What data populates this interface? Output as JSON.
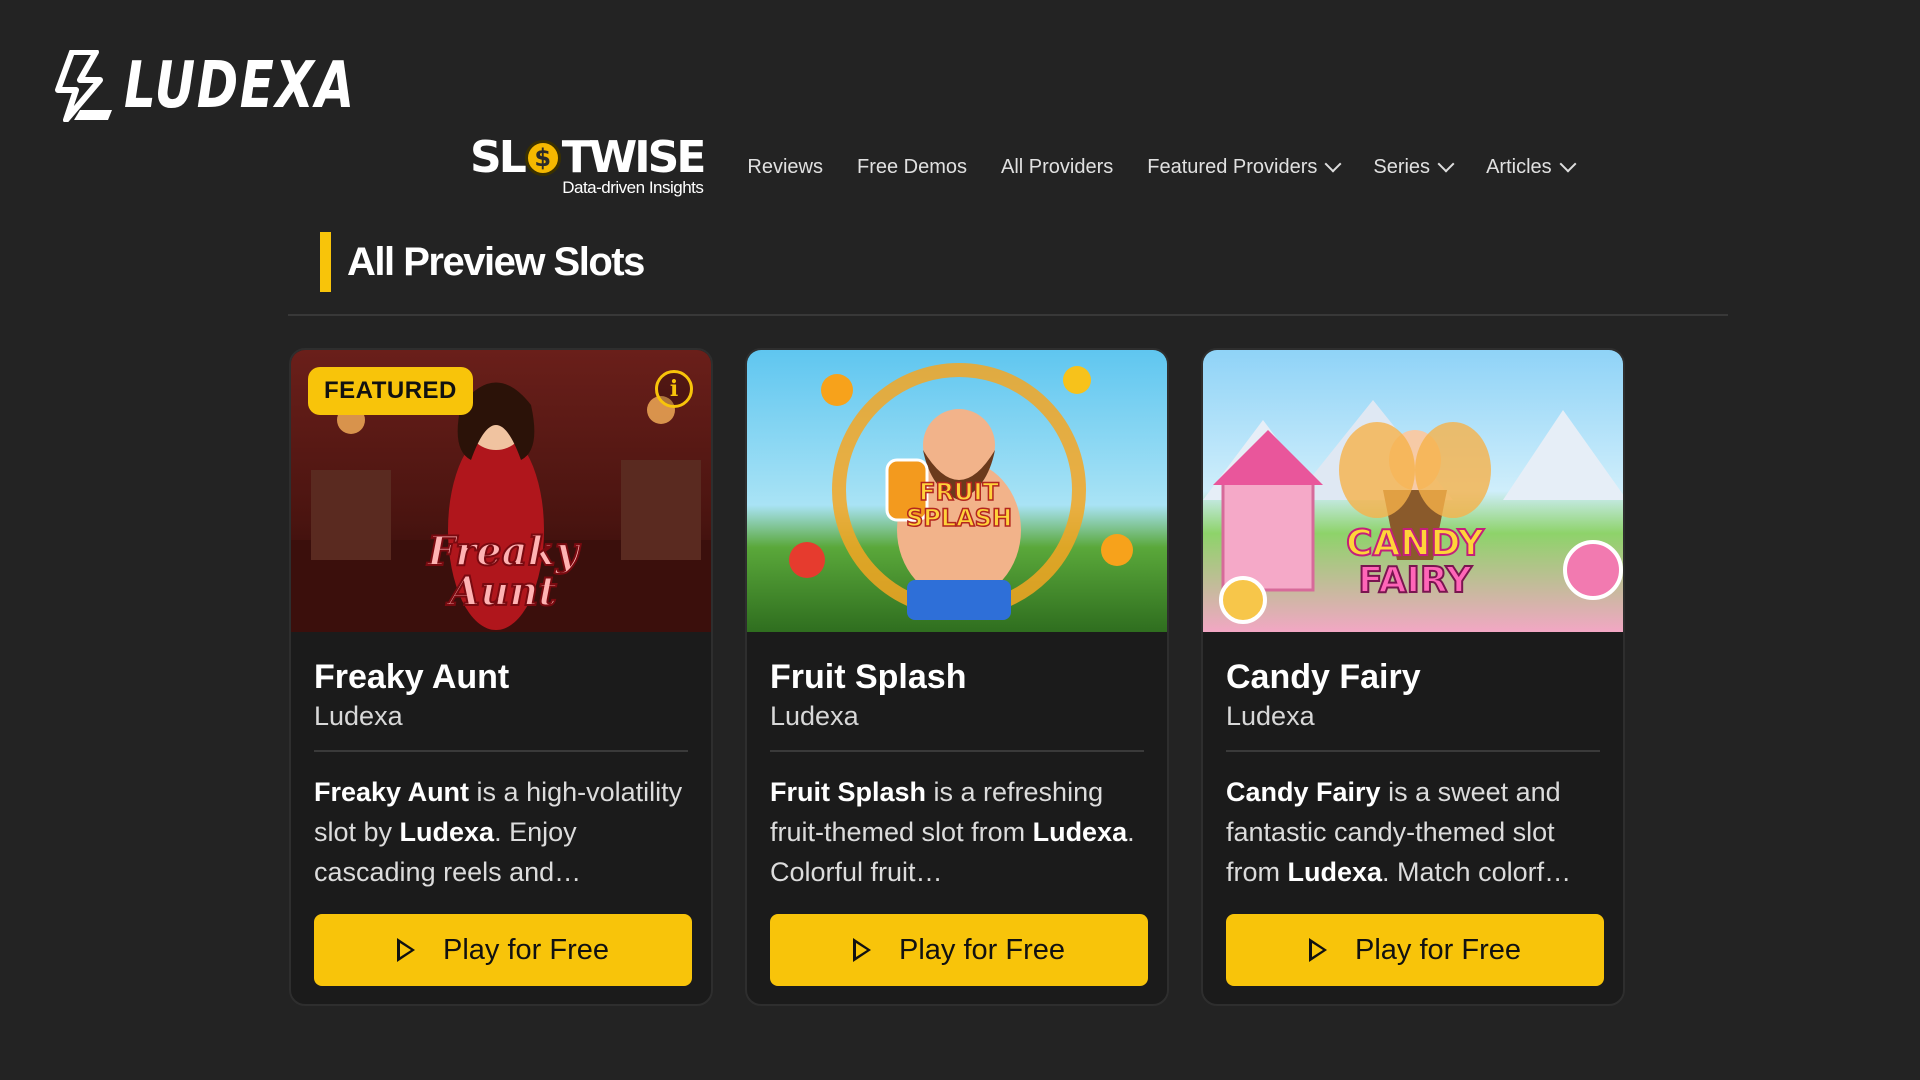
{
  "brand": {
    "name": "LUDEXA",
    "logo_icon": "lightning-l-icon"
  },
  "nav": {
    "logo_name": "SLOTWISE",
    "logo_tagline": "Data-driven Insights",
    "items": [
      {
        "label": "Reviews",
        "dropdown": false
      },
      {
        "label": "Free Demos",
        "dropdown": false
      },
      {
        "label": "All Providers",
        "dropdown": false
      },
      {
        "label": "Featured Providers",
        "dropdown": true
      },
      {
        "label": "Series",
        "dropdown": true
      },
      {
        "label": "Articles",
        "dropdown": true
      }
    ]
  },
  "section": {
    "title": "All Preview Slots"
  },
  "colors": {
    "accent": "#f8c40a",
    "background": "#232323",
    "card": "#1b1b1b"
  },
  "cards": [
    {
      "title": "Freaky Aunt",
      "provider": "Ludexa",
      "badge": "FEATURED",
      "info_icon": "info-icon",
      "art_text_1": "Freaky",
      "art_text_2": "Aunt",
      "desc_name": "Freaky Aunt",
      "desc_mid": " is a high-volatility slot by ",
      "desc_provider": "Ludexa",
      "desc_end": ". Enjoy cascading reels and…",
      "button": "Play for Free"
    },
    {
      "title": "Fruit Splash",
      "provider": "Ludexa",
      "art_text_1": "FRUIT",
      "art_text_2": "SPLASH",
      "desc_name": "Fruit Splash",
      "desc_mid": " is a refreshing fruit-themed slot from ",
      "desc_provider": "Ludexa",
      "desc_end": ". Colorful fruit…",
      "button": "Play for Free"
    },
    {
      "title": "Candy Fairy",
      "provider": "Ludexa",
      "art_text_1": "CANDY",
      "art_text_2": "FAIRY",
      "desc_name": "Candy Fairy",
      "desc_mid": " is a sweet and fantastic candy-themed slot from ",
      "desc_provider": "Ludexa",
      "desc_end": ". Match colorf…",
      "button": "Play for Free"
    }
  ]
}
